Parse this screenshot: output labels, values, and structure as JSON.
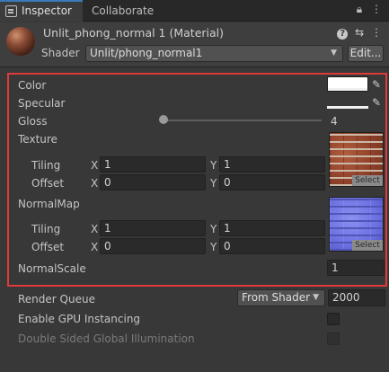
{
  "tabs": {
    "inspector_label": "Inspector",
    "collaborate_label": "Collaborate",
    "lock_icon": "lock-icon",
    "menu_icon": "kebab-menu-icon"
  },
  "header": {
    "material_title": "Unlit_phong_normal 1 (Material)",
    "shader_label": "Shader",
    "shader_value": "Unlit/phong_normal1",
    "edit_label": "Edit..."
  },
  "properties": {
    "color_label": "Color",
    "color_value": "#ffffff",
    "specular_label": "Specular",
    "specular_value": "#ffffff",
    "gloss_label": "Gloss",
    "gloss_value": "4",
    "gloss_slider_fraction": 0.0,
    "texture": {
      "label": "Texture",
      "tiling_label": "Tiling",
      "offset_label": "Offset",
      "x_label": "X",
      "y_label": "Y",
      "tiling_x": "1",
      "tiling_y": "1",
      "offset_x": "0",
      "offset_y": "0",
      "select_label": "Select"
    },
    "normalmap": {
      "label": "NormalMap",
      "tiling_label": "Tiling",
      "offset_label": "Offset",
      "x_label": "X",
      "y_label": "Y",
      "tiling_x": "1",
      "tiling_y": "1",
      "offset_x": "0",
      "offset_y": "0",
      "select_label": "Select"
    },
    "normalscale_label": "NormalScale",
    "normalscale_value": "1"
  },
  "footer": {
    "render_queue_label": "Render Queue",
    "render_queue_mode": "From Shader",
    "render_queue_value": "2000",
    "gpu_instancing_label": "Enable GPU Instancing",
    "double_sided_gi_label": "Double Sided Global Illumination"
  },
  "colors": {
    "highlight_border": "#e03a3a",
    "accent": "#3a79bb"
  }
}
